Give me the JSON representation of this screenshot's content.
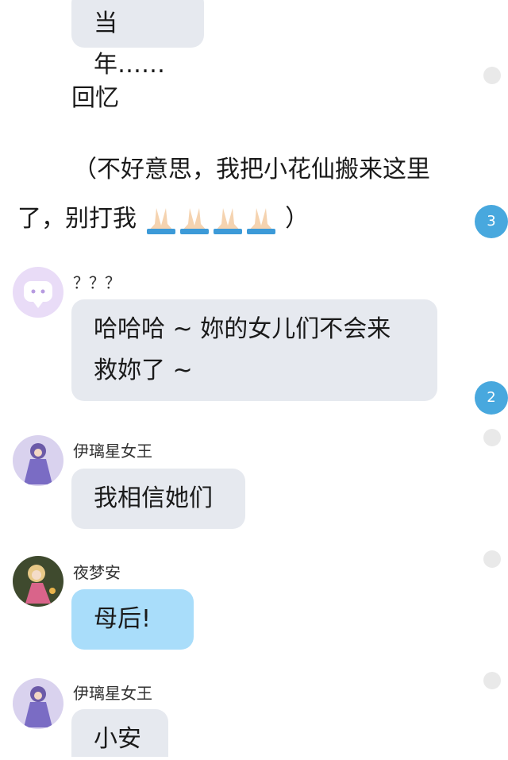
{
  "messages": {
    "top_bubble": "当年……",
    "narration_1": "回忆",
    "narration_2_line1": "（不好意思，我把小花仙搬来这里",
    "narration_2_line2_pre": "了，别打我",
    "narration_2_line2_post": "）",
    "emoji_name": "folded-hands-icon",
    "unread_1": "3",
    "unread_2": "2",
    "msg1": {
      "name": "？？？",
      "line1": "哈哈哈 ~ 妳的女儿们不会来",
      "line2": "救妳了 ~"
    },
    "msg2": {
      "name": "伊璃星女王",
      "text": "我相信她们"
    },
    "msg3": {
      "name": "夜梦安",
      "text": "母后!"
    },
    "msg4": {
      "name": "伊璃星女王",
      "text": "小安"
    }
  },
  "colors": {
    "bubble_gray": "#e6e9ef",
    "bubble_blue": "#a9ddfa",
    "unread_badge": "#48a8de",
    "read_dot": "#e9e9e9"
  }
}
